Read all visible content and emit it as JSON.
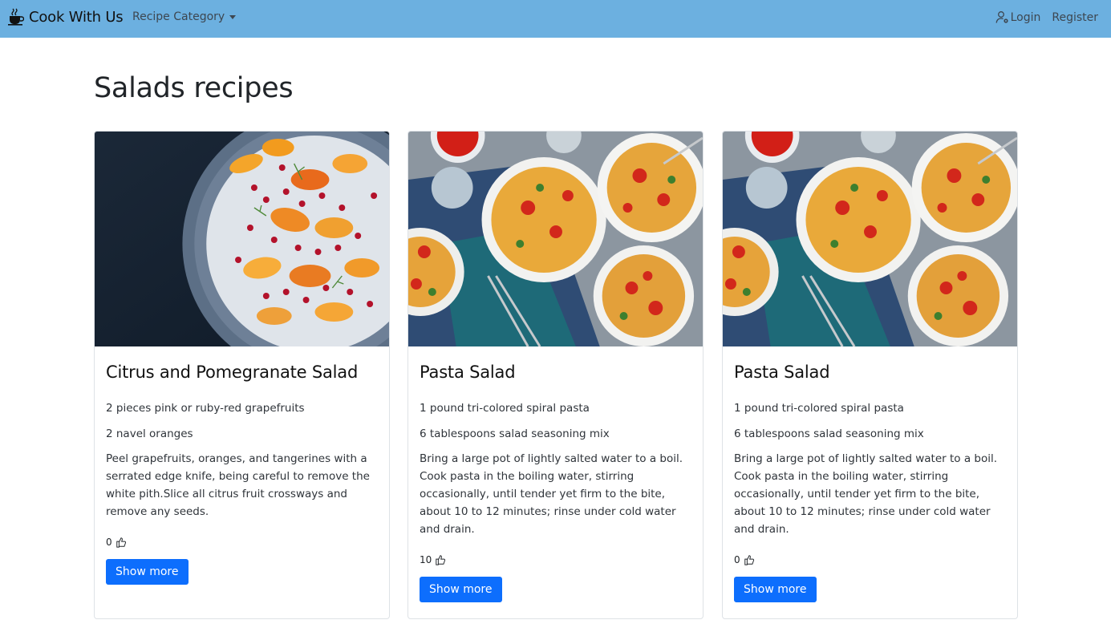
{
  "navbar": {
    "brand": "Cook With Us",
    "brand_icon": "coffee-cup-icon",
    "category_label": "Recipe Category",
    "login_label": "Login",
    "login_icon": "person-gear-icon",
    "register_label": "Register",
    "background": "#6cb0e0"
  },
  "page": {
    "title": "Salads recipes"
  },
  "cards": [
    {
      "title": "Citrus and Pomegranate Salad",
      "ingredient_1": "2 pieces pink or ruby-red grapefruits",
      "ingredient_2": "2 navel oranges",
      "description": "Peel grapefruits, oranges, and tangerines with a serrated edge knife, being careful to remove the white pith.Slice all citrus fruit crossways and remove any seeds.",
      "likes": "0",
      "button": "Show more"
    },
    {
      "title": "Pasta Salad",
      "ingredient_1": "1 pound tri-colored spiral pasta",
      "ingredient_2": "6 tablespoons salad seasoning mix",
      "description": "Bring a large pot of lightly salted water to a boil. Cook pasta in the boiling water, stirring occasionally, until tender yet firm to the bite, about 10 to 12 minutes; rinse under cold water and drain.",
      "likes": "10",
      "button": "Show more"
    },
    {
      "title": "Pasta Salad",
      "ingredient_1": "1 pound tri-colored spiral pasta",
      "ingredient_2": "6 tablespoons salad seasoning mix",
      "description": "Bring a large pot of lightly salted water to a boil. Cook pasta in the boiling water, stirring occasionally, until tender yet firm to the bite, about 10 to 12 minutes; rinse under cold water and drain.",
      "likes": "0",
      "button": "Show more"
    }
  ],
  "colors": {
    "primary_button": "#0d6efd",
    "card_border": "#dee2e6"
  }
}
